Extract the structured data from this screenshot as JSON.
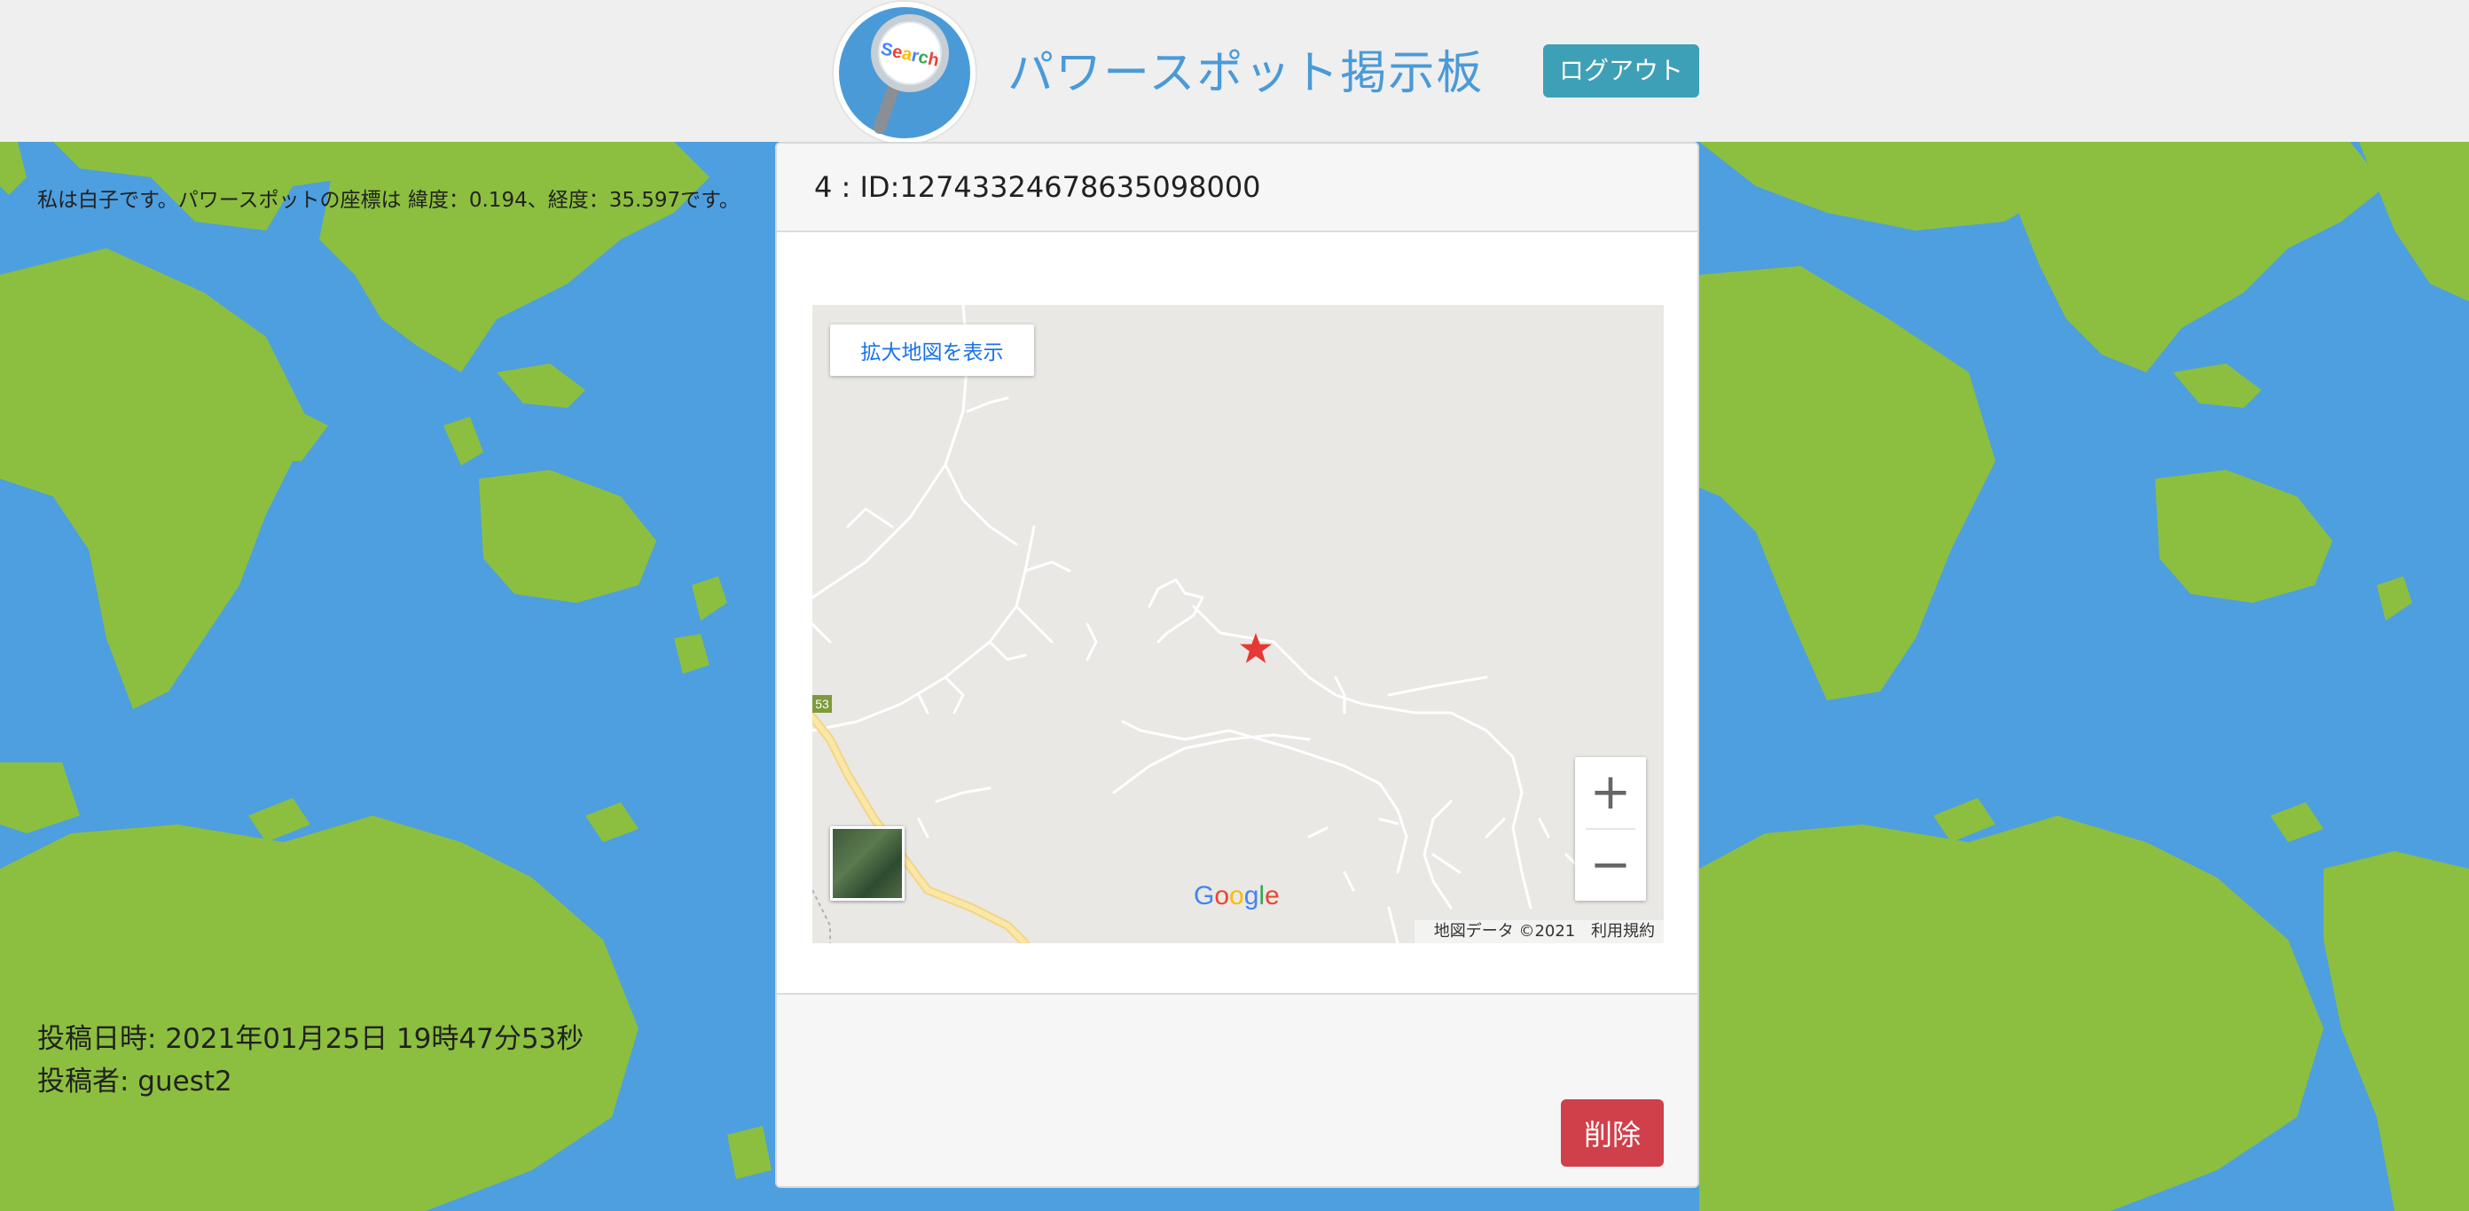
{
  "header": {
    "site_title": "パワースポット掲示板",
    "logout_label": "ログアウト",
    "logo_text": "Search"
  },
  "post": {
    "title": "4 : ID:12743324678635098000",
    "message": "私は白子です。パワースポットの座標は 緯度：0.194、経度：35.597です。",
    "date_line": "投稿日時: 2021年01月25日 19時47分53秒",
    "author_line": "投稿者: guest2",
    "delete_label": "削除"
  },
  "map": {
    "enlarge_label": "拡大地図を表示",
    "zoom_in": "+",
    "zoom_out": "−",
    "attribution": "地図データ ©2021",
    "terms": "利用規約",
    "route_shield": "53",
    "google_letters": [
      "G",
      "o",
      "o",
      "g",
      "l",
      "e"
    ],
    "google_colors": [
      "#4285F4",
      "#EA4335",
      "#FBBC05",
      "#4285F4",
      "#34A853",
      "#EA4335"
    ],
    "marker_icon": "red-star-icon",
    "marker_color": "#e53935"
  },
  "colors": {
    "ocean": "#4d9fdf",
    "land": "#8cbf3f",
    "header_bg": "#efefef",
    "logout_bg": "#3ea0b6",
    "delete_bg": "#d0404a",
    "title_color": "#4a9ad8"
  }
}
